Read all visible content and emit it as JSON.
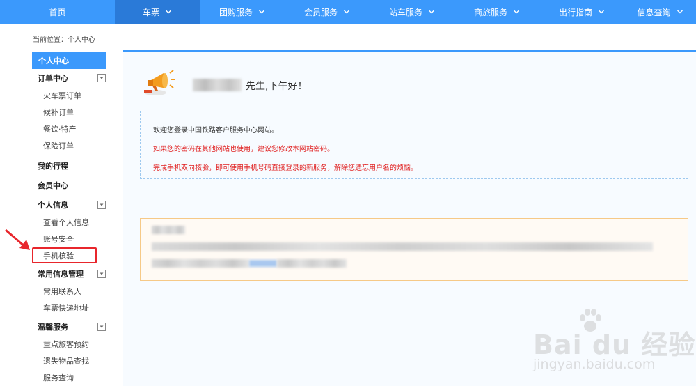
{
  "nav": {
    "items": [
      {
        "label": "首页",
        "has_menu": false,
        "active": false
      },
      {
        "label": "车票",
        "has_menu": true,
        "active": true
      },
      {
        "label": "团购服务",
        "has_menu": true,
        "active": false
      },
      {
        "label": "会员服务",
        "has_menu": true,
        "active": false
      },
      {
        "label": "站车服务",
        "has_menu": true,
        "active": false
      },
      {
        "label": "商旅服务",
        "has_menu": true,
        "active": false
      },
      {
        "label": "出行指南",
        "has_menu": true,
        "active": false
      },
      {
        "label": "信息查询",
        "has_menu": true,
        "active": false
      }
    ]
  },
  "breadcrumb": "当前位置：个人中心",
  "sidebar": {
    "head": "个人中心",
    "groups": [
      {
        "label": "订单中心",
        "toggle": true,
        "items": [
          "火车票订单",
          "候补订单",
          "餐饮·特产",
          "保险订单"
        ]
      },
      {
        "label": "我的行程",
        "toggle": false,
        "items": []
      },
      {
        "label": "会员中心",
        "toggle": false,
        "items": []
      },
      {
        "label": "个人信息",
        "toggle": true,
        "items": [
          "查看个人信息",
          "账号安全",
          "手机核验"
        ]
      },
      {
        "label": "常用信息管理",
        "toggle": true,
        "items": [
          "常用联系人",
          "车票快递地址"
        ]
      },
      {
        "label": "温馨服务",
        "toggle": true,
        "items": [
          "重点旅客预约",
          "遗失物品查找",
          "服务查询"
        ]
      }
    ],
    "highlighted_item": "手机核验"
  },
  "main": {
    "greeting": "先生,下午好！",
    "notice": {
      "line1": "欢迎您登录中国铁路客户服务中心网站。",
      "line2": "如果您的密码在其他网站也使用，建议您修改本网站密码。",
      "line3": "完成手机双向核验，即可使用手机号码直接登录的新服务，解除您遗忘用户名的烦恼。"
    }
  },
  "watermark": {
    "logo": "Bai du 经验",
    "url": "jingyan.baidu.com"
  },
  "colors": {
    "nav_bg": "#3b99fc",
    "nav_active": "#2a7ad8",
    "highlight_border": "#e8262c",
    "notice_red": "#e02020",
    "info_border": "#f6c987"
  }
}
